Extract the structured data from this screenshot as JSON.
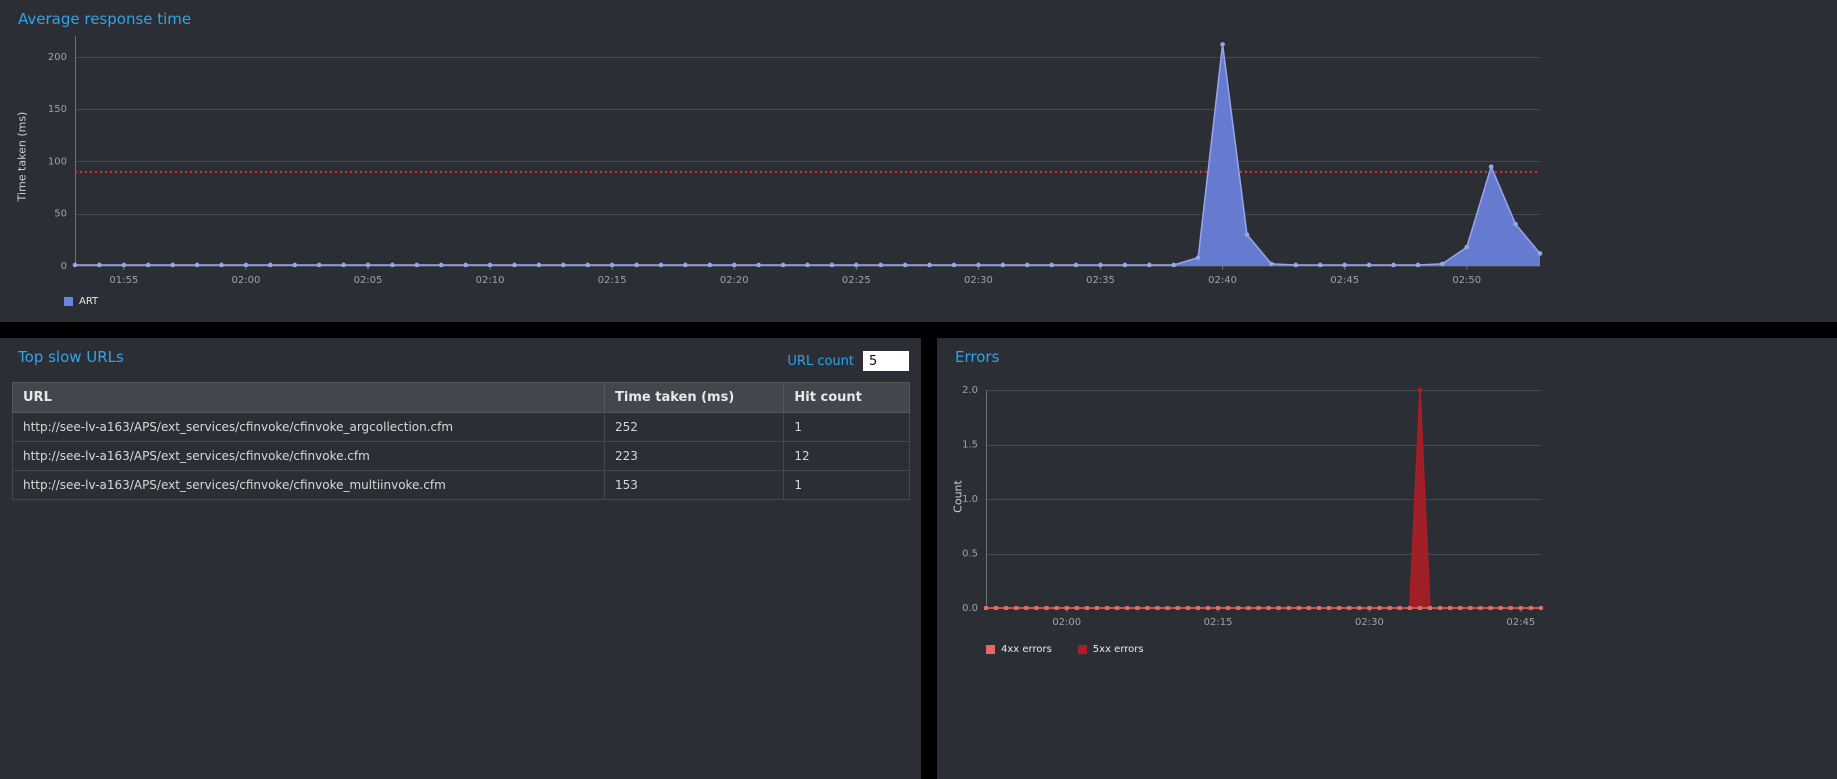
{
  "colors": {
    "accent": "#2fa4e7",
    "panel_bg": "#2b2e34",
    "page_bg": "#000000",
    "grid": "#46494f",
    "axis": "#6e7277",
    "text_muted": "#9fa2a6",
    "threshold": "#ed2d24",
    "table_header_bg": "#43474d"
  },
  "slow_urls": {
    "title": "Top slow URLs",
    "url_count_label": "URL count",
    "url_count": "5",
    "columns": [
      "URL",
      "Time taken (ms)",
      "Hit count"
    ],
    "rows": [
      {
        "url": "http://see-lv-a163/APS/ext_services/cfinvoke/cfinvoke_argcollection.cfm",
        "time": "252",
        "hits": "1"
      },
      {
        "url": "http://see-lv-a163/APS/ext_services/cfinvoke/cfinvoke.cfm",
        "time": "223",
        "hits": "12"
      },
      {
        "url": "http://see-lv-a163/APS/ext_services/cfinvoke/cfinvoke_multiinvoke.cfm",
        "time": "153",
        "hits": "1"
      }
    ]
  },
  "chart_data": [
    {
      "type": "area",
      "title": "Average response time",
      "ylabel": "Time taken (ms)",
      "ylim": [
        0,
        220
      ],
      "yticks": [
        0,
        50,
        100,
        150,
        200
      ],
      "ytick_labels": [
        "0",
        "50",
        "100",
        "150",
        "200"
      ],
      "threshold": 90,
      "legend_position": "bottom-left",
      "grid": true,
      "x": [
        "01:53",
        "01:54",
        "01:55",
        "01:56",
        "01:57",
        "01:58",
        "01:59",
        "02:00",
        "02:01",
        "02:02",
        "02:03",
        "02:04",
        "02:05",
        "02:06",
        "02:07",
        "02:08",
        "02:09",
        "02:10",
        "02:11",
        "02:12",
        "02:13",
        "02:14",
        "02:15",
        "02:16",
        "02:17",
        "02:18",
        "02:19",
        "02:20",
        "02:21",
        "02:22",
        "02:23",
        "02:24",
        "02:25",
        "02:26",
        "02:27",
        "02:28",
        "02:29",
        "02:30",
        "02:31",
        "02:32",
        "02:33",
        "02:34",
        "02:35",
        "02:36",
        "02:37",
        "02:38",
        "02:39",
        "02:40",
        "02:41",
        "02:42",
        "02:43",
        "02:44",
        "02:45",
        "02:46",
        "02:47",
        "02:48",
        "02:49",
        "02:50",
        "02:51",
        "02:52",
        "02:53"
      ],
      "xticks": [
        "01:55",
        "02:00",
        "02:05",
        "02:10",
        "02:15",
        "02:20",
        "02:25",
        "02:30",
        "02:35",
        "02:40",
        "02:45",
        "02:50"
      ],
      "series": [
        {
          "name": "ART",
          "color": "#6d83e0",
          "line_color": "#97a6ec",
          "marker": "circle",
          "values": [
            1,
            1,
            1,
            1,
            1,
            1,
            1,
            1,
            1,
            1,
            1,
            1,
            1,
            1,
            1,
            1,
            1,
            1,
            1,
            1,
            1,
            1,
            1,
            1,
            1,
            1,
            1,
            1,
            1,
            1,
            1,
            1,
            1,
            1,
            1,
            1,
            1,
            1,
            1,
            1,
            1,
            1,
            1,
            1,
            1,
            1,
            8,
            212,
            30,
            2,
            1,
            1,
            1,
            1,
            1,
            1,
            2,
            18,
            95,
            40,
            12
          ]
        }
      ]
    },
    {
      "type": "area",
      "title": "Errors",
      "ylabel": "Count",
      "ylim": [
        0,
        2
      ],
      "yticks": [
        0,
        0.5,
        1,
        1.5,
        2
      ],
      "ytick_labels": [
        "0.0",
        "0.5",
        "1.0",
        "1.5",
        "2.0"
      ],
      "legend_position": "bottom-left",
      "grid": true,
      "x": [
        "01:52",
        "01:53",
        "01:54",
        "01:55",
        "01:56",
        "01:57",
        "01:58",
        "01:59",
        "02:00",
        "02:01",
        "02:02",
        "02:03",
        "02:04",
        "02:05",
        "02:06",
        "02:07",
        "02:08",
        "02:09",
        "02:10",
        "02:11",
        "02:12",
        "02:13",
        "02:14",
        "02:15",
        "02:16",
        "02:17",
        "02:18",
        "02:19",
        "02:20",
        "02:21",
        "02:22",
        "02:23",
        "02:24",
        "02:25",
        "02:26",
        "02:27",
        "02:28",
        "02:29",
        "02:30",
        "02:31",
        "02:32",
        "02:33",
        "02:34",
        "02:35",
        "02:36",
        "02:37",
        "02:38",
        "02:39",
        "02:40",
        "02:41",
        "02:42",
        "02:43",
        "02:44",
        "02:45",
        "02:46",
        "02:47"
      ],
      "xticks": [
        "02:00",
        "02:15",
        "02:30",
        "02:45"
      ],
      "series": [
        {
          "name": "4xx errors",
          "color": "#e4695f",
          "line_color": "#e4695f",
          "marker": "square",
          "values": [
            0,
            0,
            0,
            0,
            0,
            0,
            0,
            0,
            0,
            0,
            0,
            0,
            0,
            0,
            0,
            0,
            0,
            0,
            0,
            0,
            0,
            0,
            0,
            0,
            0,
            0,
            0,
            0,
            0,
            0,
            0,
            0,
            0,
            0,
            0,
            0,
            0,
            0,
            0,
            0,
            0,
            0,
            0,
            0,
            0,
            0,
            0,
            0,
            0,
            0,
            0,
            0,
            0,
            0,
            0,
            0
          ]
        },
        {
          "name": "5xx errors",
          "color": "#ab1e24",
          "line_color": "#ab1e24",
          "marker": "square",
          "values": [
            0,
            0,
            0,
            0,
            0,
            0,
            0,
            0,
            0,
            0,
            0,
            0,
            0,
            0,
            0,
            0,
            0,
            0,
            0,
            0,
            0,
            0,
            0,
            0,
            0,
            0,
            0,
            0,
            0,
            0,
            0,
            0,
            0,
            0,
            0,
            0,
            0,
            0,
            0,
            0,
            0,
            0,
            0,
            2,
            0,
            0,
            0,
            0,
            0,
            0,
            0,
            0,
            0,
            0,
            0,
            0
          ]
        }
      ]
    }
  ]
}
